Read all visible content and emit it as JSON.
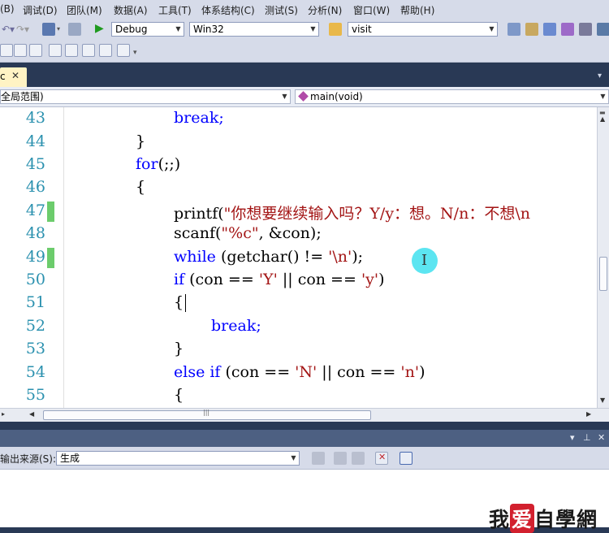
{
  "menu": {
    "items": [
      "(B)",
      "调试(D)",
      "团队(M)",
      "数据(A)",
      "工具(T)",
      "体系结构(C)",
      "测试(S)",
      "分析(N)",
      "窗口(W)",
      "帮助(H)"
    ]
  },
  "toolbar": {
    "config_value": "Debug",
    "platform_value": "Win32",
    "find_value": "visit"
  },
  "tab": {
    "label": "c"
  },
  "navbar": {
    "scope_value": "全局范围)",
    "function_value": "main(void)"
  },
  "editor": {
    "line_numbers": [
      "43",
      "44",
      "45",
      "46",
      "47",
      "48",
      "49",
      "50",
      "51",
      "52",
      "53",
      "54",
      "55"
    ],
    "lines": {
      "l43": "break;",
      "l44": "}",
      "l45_kw": "for",
      "l45_rest": "(;;)",
      "l46": "{",
      "l47_a": "printf(",
      "l47_str": "\"你想要继续输入吗？Y/y：想。N/n：不想\\n",
      "l48_a": "scanf(",
      "l48_str": "\"%c\"",
      "l48_b": ", &con);",
      "l49_kw": "while",
      "l49_a": " (getchar() != ",
      "l49_str": "'\\n'",
      "l49_b": ");",
      "l50_kw": "if",
      "l50_a": " (con == ",
      "l50_str1": "'Y'",
      "l50_b": " || con == ",
      "l50_str2": "'y'",
      "l50_c": ")",
      "l51": "{",
      "l52": "break;",
      "l53": "}",
      "l54_kw": "else if",
      "l54_a": " (con == ",
      "l54_str1": "'N'",
      "l54_b": " || con == ",
      "l54_str2": "'n'",
      "l54_c": ")",
      "l55": "{"
    }
  },
  "output": {
    "source_label": "输出来源(S):",
    "source_value": "生成"
  },
  "watermark": {
    "part1": "我",
    "part2": "爱",
    "part3": "自學網"
  },
  "colors": {
    "keyword": "#0000ff",
    "string": "#a31515",
    "line_number": "#2b91af",
    "change_marker": "#6ccc6c"
  }
}
